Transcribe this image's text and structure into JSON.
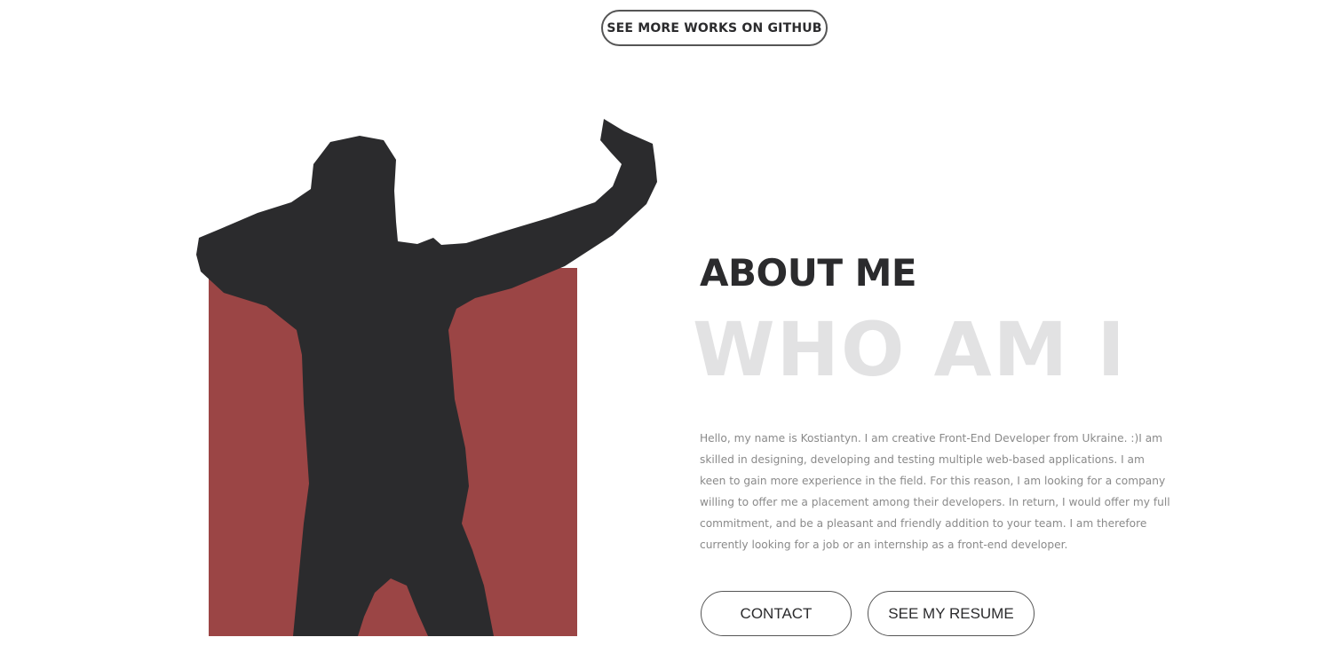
{
  "header": {
    "github_button_label": "SEE MORE WORKS ON GITHUB"
  },
  "about": {
    "title": "ABOUT ME",
    "subtitle": "WHO AM I",
    "bio": "Hello, my name is Kostiantyn. I am creative Front-End Developer from Ukraine. :)I am skilled in designing, developing and testing multiple web-based applications. I am keen to gain more experience in the field. For this reason, I am looking for a company willing to offer me a placement among their developers. In return, I would offer my full commitment, and be a pleasant and friendly addition to your team. I am therefore currently looking for a job or an internship as a front-end developer.",
    "contact_button_label": "CONTACT",
    "resume_button_label": "SEE MY RESUME"
  },
  "colors": {
    "accent_block": "#9b4545",
    "silhouette": "#2b2b2d",
    "heading": "#2b2b2d",
    "subtitle_ghost": "#e2e2e3",
    "body_text": "#8a8a8a"
  }
}
